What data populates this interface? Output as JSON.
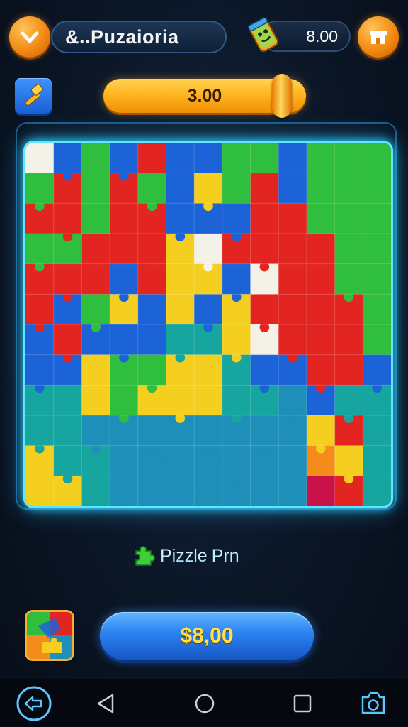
{
  "header": {
    "title": "&..Puzaioria",
    "coins": "8.00",
    "menu_icon": "chevron-down-icon",
    "store_icon": "shop-icon",
    "coin_icon": "coin-bag-icon"
  },
  "toolbar": {
    "tool_icon": "hammer-icon",
    "progress_value": "3.00",
    "progress_fraction": 0.88
  },
  "board": {
    "rows": 12,
    "cols": 13,
    "colors": {
      "R": "#e32522",
      "G": "#2fbe3d",
      "B": "#1d63d8",
      "Y": "#f4cf1f",
      "T": "#17a5a0",
      "C": "#1d8fb8",
      "W": "#f4f1e8",
      "O": "#f48b1b",
      "M": "#c9114a"
    },
    "grid": [
      "WBGBRBBGGBGGG",
      "GRGRGBYGRBGGG",
      "RRGRRBBBRRGGG",
      "GGRRRYWRRRRGG",
      "RRRBRYYBWRRGG",
      "RBGYBYBYRRRRG",
      "BRBBBTTYWRRRG",
      "BBYGGYYTBBRRB",
      "TTYGYYYTTCBTT",
      "TTCCCCCCCCYRT",
      "YTTCCCCCCCOYT",
      "YYTCCCCCCCMRT"
    ]
  },
  "label": {
    "text_part1": "Pizzle",
    "text_part2": "Prn",
    "icon": "puzzle-piece-icon"
  },
  "action": {
    "thumb_icon": "puzzle-thumbnail-icon",
    "buy_label": "$8,00"
  },
  "navbar": {
    "icons": [
      "back-circle-icon",
      "triangle-back-icon",
      "home-circle-icon",
      "recents-square-icon",
      "camera-icon"
    ]
  }
}
